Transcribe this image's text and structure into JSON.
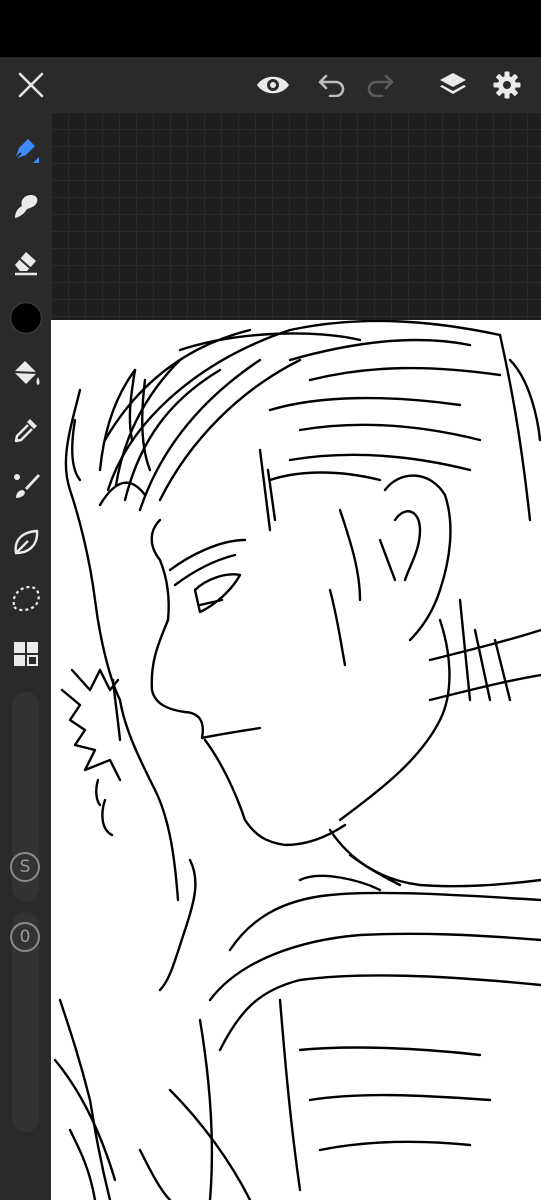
{
  "app": {
    "toolbar": {
      "close": "close-icon",
      "preview": "eye-icon",
      "undo": "undo-icon",
      "redo": "redo-icon",
      "layers": "layers-icon",
      "settings": "gear-icon"
    },
    "tools": [
      {
        "name": "brush",
        "icon": "pen-icon",
        "active": true
      },
      {
        "name": "smudge",
        "icon": "smudge-icon"
      },
      {
        "name": "eraser",
        "icon": "eraser-icon"
      },
      {
        "name": "color",
        "icon": "color-swatch",
        "value": "#000000"
      },
      {
        "name": "fill",
        "icon": "paint-bucket-icon"
      },
      {
        "name": "eyedropper",
        "icon": "eyedropper-icon"
      },
      {
        "name": "brush-settings",
        "icon": "brush-settings-icon"
      },
      {
        "name": "vector",
        "icon": "leaf-icon"
      },
      {
        "name": "selection",
        "icon": "lasso-icon"
      },
      {
        "name": "apps",
        "icon": "grid-icon"
      }
    ],
    "size_badge": "S",
    "opacity_badge": "0",
    "accent_color": "#3d8bff",
    "canvas_background": "#ffffff",
    "workspace_background": "#1f1f1f"
  }
}
